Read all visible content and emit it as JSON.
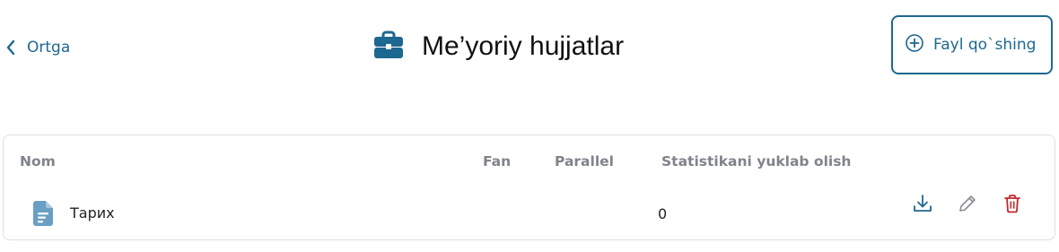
{
  "header": {
    "back_label": "Ortga",
    "title": "Me’yoriy hujjatlar",
    "add_file_label": "Fayl qo`shing"
  },
  "table": {
    "columns": {
      "name": "Nom",
      "fan": "Fan",
      "parallel": "Parallel",
      "statistics": "Statistikani yuklab olish"
    },
    "rows": [
      {
        "name": "Тарих",
        "fan": "",
        "parallel": "",
        "statistics": "0",
        "actions": [
          "download-icon",
          "pencil-icon",
          "trash-icon"
        ]
      }
    ]
  },
  "colors": {
    "accent": "#1d6890",
    "file_icon": "#6a9fc4",
    "delete": "#c0282d",
    "header_text": "#80838b"
  },
  "icons": {
    "back": "chevron-left-icon",
    "title": "briefcase-icon",
    "add": "plus-circle-icon",
    "file": "file-text-icon"
  }
}
